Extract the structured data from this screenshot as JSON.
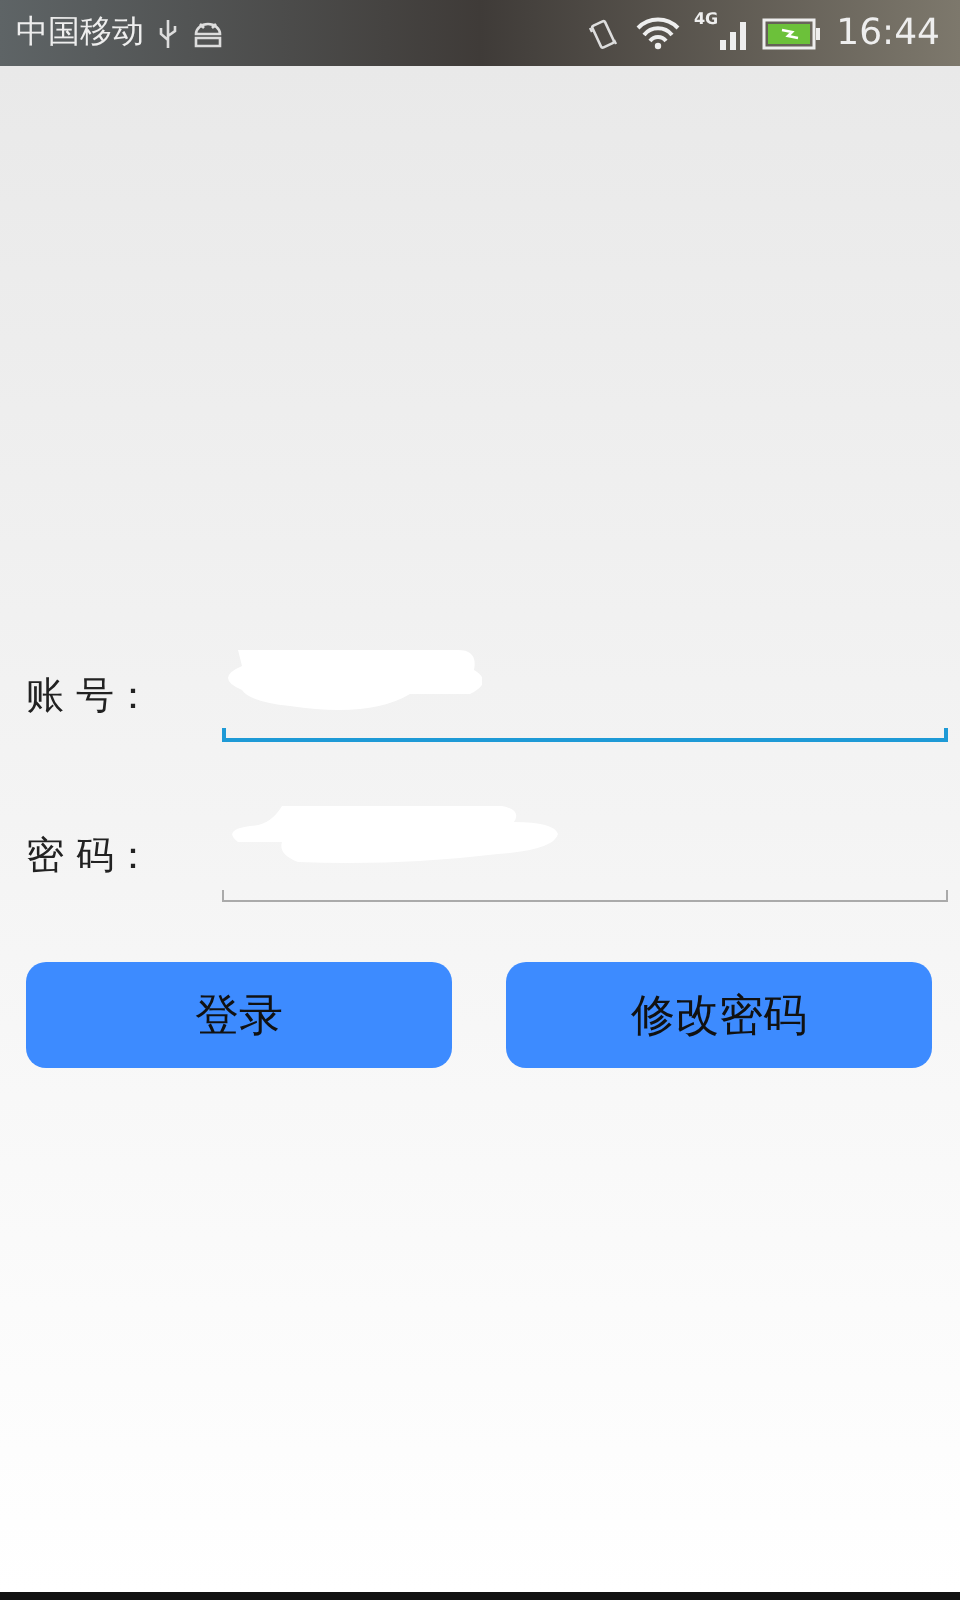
{
  "status_bar": {
    "carrier": "中国移动",
    "network": "4G",
    "time": "16:44"
  },
  "form": {
    "fields": [
      {
        "label": "账 号：",
        "focused": true,
        "kind": "text"
      },
      {
        "label": "密 码：",
        "focused": false,
        "kind": "password"
      }
    ],
    "buttons": [
      "登录",
      "修改密码"
    ]
  }
}
